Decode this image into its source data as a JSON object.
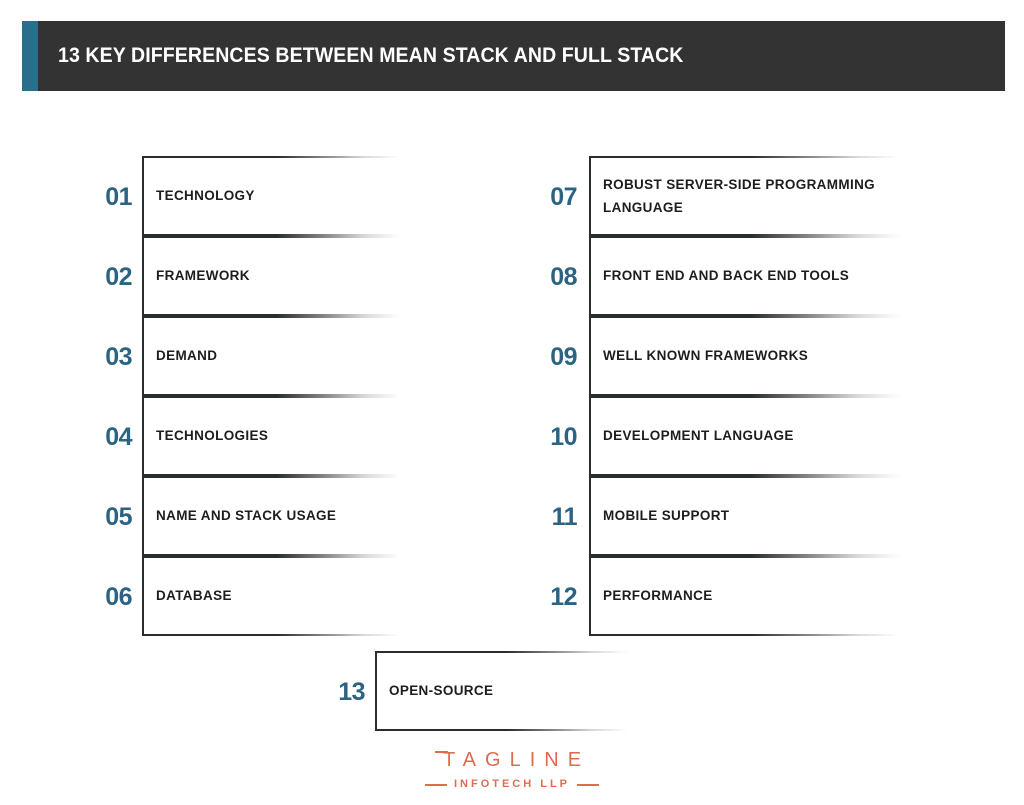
{
  "header": {
    "title": "13 KEY DIFFERENCES BETWEEN MEAN STACK AND FULL STACK",
    "accent_color": "#2a6e8e",
    "background_color": "#333333",
    "text_color": "#ffffff"
  },
  "theme": {
    "page_background": "#ffffff",
    "number_color": "#2b6382",
    "label_color": "#1d1d1d",
    "box_border_color": "#2b2f2b",
    "logo_color": "#e06c50"
  },
  "columns": {
    "left": [
      {
        "number": "01",
        "label": "TECHNOLOGY"
      },
      {
        "number": "02",
        "label": "FRAMEWORK"
      },
      {
        "number": "03",
        "label": "DEMAND"
      },
      {
        "number": "04",
        "label": "TECHNOLOGIES"
      },
      {
        "number": "05",
        "label": "NAME AND STACK USAGE"
      },
      {
        "number": "06",
        "label": "DATABASE"
      }
    ],
    "right": [
      {
        "number": "07",
        "label": "ROBUST SERVER-SIDE PROGRAMMING LANGUAGE"
      },
      {
        "number": "08",
        "label": "FRONT END AND BACK END TOOLS"
      },
      {
        "number": "09",
        "label": "WELL KNOWN FRAMEWORKS"
      },
      {
        "number": "10",
        "label": "DEVELOPMENT LANGUAGE"
      },
      {
        "number": "11",
        "label": "MOBILE SUPPORT"
      },
      {
        "number": "12",
        "label": "PERFORMANCE"
      }
    ],
    "final": [
      {
        "number": "13",
        "label": "OPEN-SOURCE"
      }
    ]
  },
  "footer": {
    "wordmark": "TAGLINE",
    "subline": "INFOTECH LLP"
  }
}
